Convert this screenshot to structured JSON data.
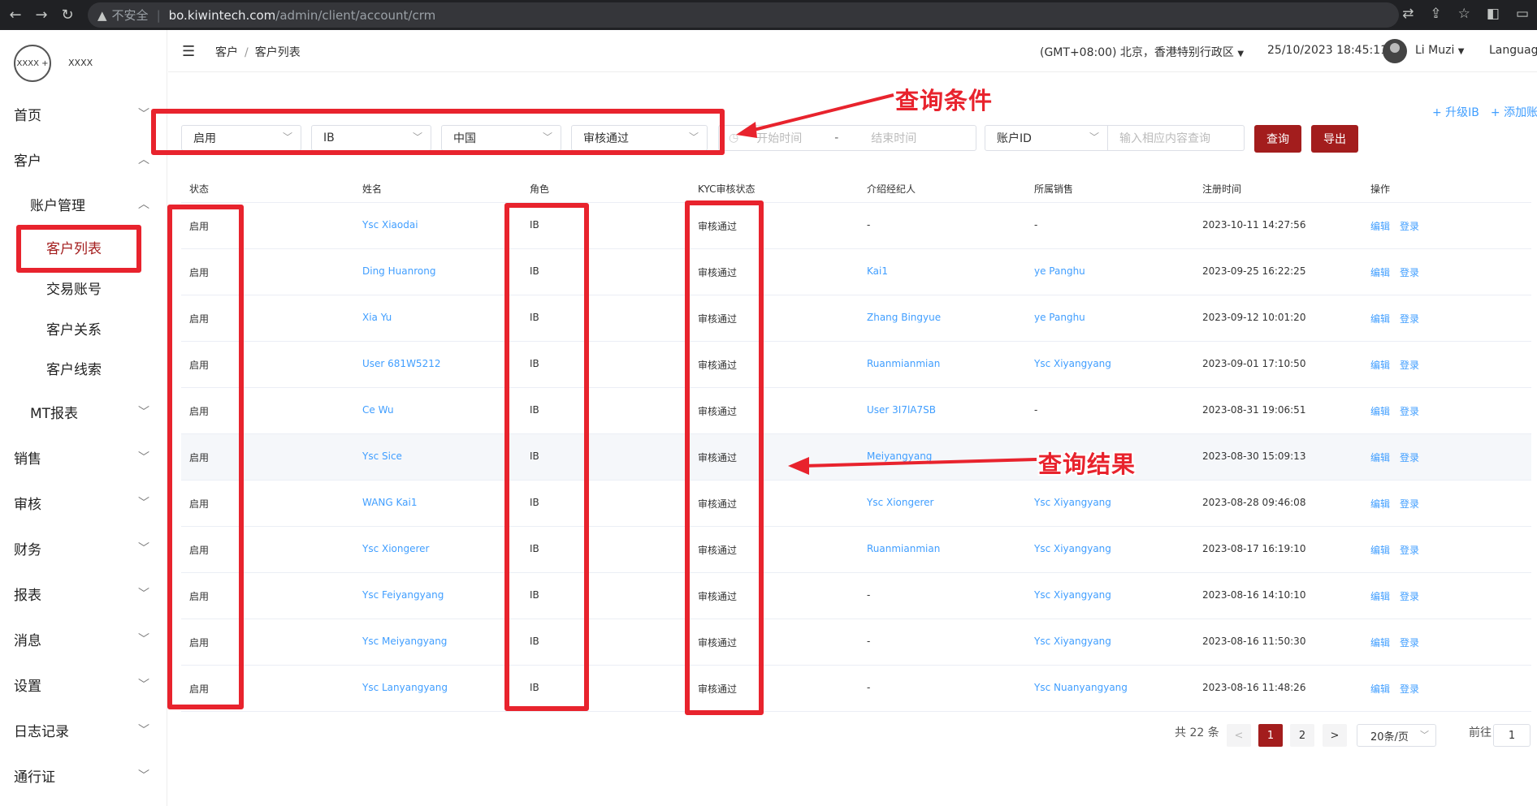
{
  "browser": {
    "insecure_label": "不安全",
    "url_host": "bo.kiwintech.com",
    "url_path": "/admin/client/account/crm"
  },
  "logo": {
    "circle_text": "XXXX +",
    "name": "XXXX"
  },
  "sidebar": {
    "home": "首页",
    "customer": "客户",
    "account_mgmt": "账户管理",
    "client_list": "客户列表",
    "trading_account": "交易账号",
    "client_relation": "客户关系",
    "client_leads": "客户线索",
    "mt_report": "MT报表",
    "sales": "销售",
    "audit": "审核",
    "finance": "财务",
    "reports": "报表",
    "messages": "消息",
    "settings": "设置",
    "logs": "日志记录",
    "pass": "通行证"
  },
  "header": {
    "breadcrumb_root": "客户",
    "breadcrumb_sep": "/",
    "breadcrumb_current": "客户列表",
    "timezone": "(GMT+08:00) 北京，香港特别行政区",
    "datetime": "25/10/2023 18:45:11",
    "user": "Li Muzi",
    "language": "Language"
  },
  "top_links": {
    "upgrade_ib": "+ 升级IB",
    "add_account": "+ 添加账户"
  },
  "filters": {
    "status": "启用",
    "role": "IB",
    "country": "中国",
    "kyc": "审核通过",
    "start_placeholder": "开始时间",
    "range_sep": "-",
    "end_placeholder": "结束时间",
    "account_type": "账户ID",
    "search_placeholder": "输入相应内容查询",
    "query_btn": "查询",
    "export_btn": "导出"
  },
  "table": {
    "headers": [
      "状态",
      "姓名",
      "角色",
      "KYC审核状态",
      "介绍经纪人",
      "所属销售",
      "注册时间",
      "操作"
    ],
    "action_edit": "编辑",
    "action_login": "登录",
    "rows": [
      {
        "status": "启用",
        "name": "Ysc Xiaodai",
        "role": "IB",
        "kyc": "审核通过",
        "ib": "-",
        "sales": "-",
        "time": "2023-10-11 14:27:56"
      },
      {
        "status": "启用",
        "name": "Ding Huanrong",
        "role": "IB",
        "kyc": "审核通过",
        "ib": "Kai1",
        "sales": "ye Panghu",
        "time": "2023-09-25 16:22:25"
      },
      {
        "status": "启用",
        "name": "Xia Yu",
        "role": "IB",
        "kyc": "审核通过",
        "ib": "Zhang Bingyue",
        "sales": "ye Panghu",
        "time": "2023-09-12 10:01:20"
      },
      {
        "status": "启用",
        "name": "User 681W5212",
        "role": "IB",
        "kyc": "审核通过",
        "ib": "Ruanmianmian",
        "sales": "Ysc Xiyangyang",
        "time": "2023-09-01 17:10:50"
      },
      {
        "status": "启用",
        "name": "Ce Wu",
        "role": "IB",
        "kyc": "审核通过",
        "ib": "User 3I7lA7SB",
        "sales": "-",
        "time": "2023-08-31 19:06:51"
      },
      {
        "status": "启用",
        "name": "Ysc Sice",
        "role": "IB",
        "kyc": "审核通过",
        "ib": "Meiyangyang",
        "sales": "",
        "time": "2023-08-30 15:09:13"
      },
      {
        "status": "启用",
        "name": "WANG Kai1",
        "role": "IB",
        "kyc": "审核通过",
        "ib": "Ysc Xiongerer",
        "sales": "Ysc Xiyangyang",
        "time": "2023-08-28 09:46:08"
      },
      {
        "status": "启用",
        "name": "Ysc Xiongerer",
        "role": "IB",
        "kyc": "审核通过",
        "ib": "Ruanmianmian",
        "sales": "Ysc Xiyangyang",
        "time": "2023-08-17 16:19:10"
      },
      {
        "status": "启用",
        "name": "Ysc Feiyangyang",
        "role": "IB",
        "kyc": "审核通过",
        "ib": "-",
        "sales": "Ysc Xiyangyang",
        "time": "2023-08-16 14:10:10"
      },
      {
        "status": "启用",
        "name": "Ysc Meiyangyang",
        "role": "IB",
        "kyc": "审核通过",
        "ib": "-",
        "sales": "Ysc Xiyangyang",
        "time": "2023-08-16 11:50:30"
      },
      {
        "status": "启用",
        "name": "Ysc Lanyangyang",
        "role": "IB",
        "kyc": "审核通过",
        "ib": "-",
        "sales": "Ysc Nuanyangyang",
        "time": "2023-08-16 11:48:26"
      }
    ]
  },
  "pagination": {
    "total": "共 22 条",
    "prev": "<",
    "page1": "1",
    "page2": "2",
    "next": ">",
    "page_size": "20条/页",
    "goto_label": "前往",
    "goto_value": "1"
  },
  "annotations": {
    "query_conditions": "查询条件",
    "query_results": "查询结果"
  },
  "colors": {
    "brand": "#a31d1d",
    "link": "#409eff",
    "annotation": "#e8232d"
  }
}
